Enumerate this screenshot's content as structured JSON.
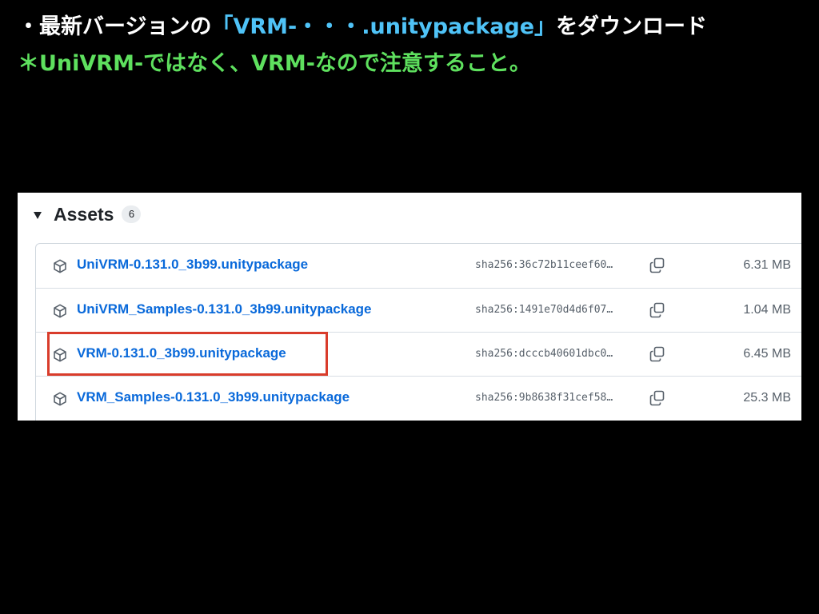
{
  "instructions": {
    "line1_prefix": "・最新バージョンの",
    "line1_accent": "「VRM-・・・.unitypackage」",
    "line1_suffix": "をダウンロード",
    "line2": "＊UniVRM-ではなく、VRM-なので注意すること。"
  },
  "assets": {
    "title": "Assets",
    "count": "6",
    "rows": [
      {
        "name": "UniVRM-0.131.0_3b99.unitypackage",
        "sha": "sha256:36c72b11ceef60…",
        "size": "6.31 MB",
        "icon": "package-icon"
      },
      {
        "name": "UniVRM_Samples-0.131.0_3b99.unitypackage",
        "sha": "sha256:1491e70d4d6f07…",
        "size": "1.04 MB",
        "icon": "package-icon"
      },
      {
        "name": "VRM-0.131.0_3b99.unitypackage",
        "sha": "sha256:dcccb40601dbc0…",
        "size": "6.45 MB",
        "icon": "package-icon"
      },
      {
        "name": "VRM_Samples-0.131.0_3b99.unitypackage",
        "sha": "sha256:9b8638f31cef58…",
        "size": "25.3 MB",
        "icon": "package-icon"
      }
    ]
  },
  "colors": {
    "background": "#000000",
    "title_text": "#ffffff",
    "accent_text": "#4fc3f7",
    "note_text": "#5ee05e",
    "link": "#0969da",
    "highlight_box": "#d93c2b"
  }
}
